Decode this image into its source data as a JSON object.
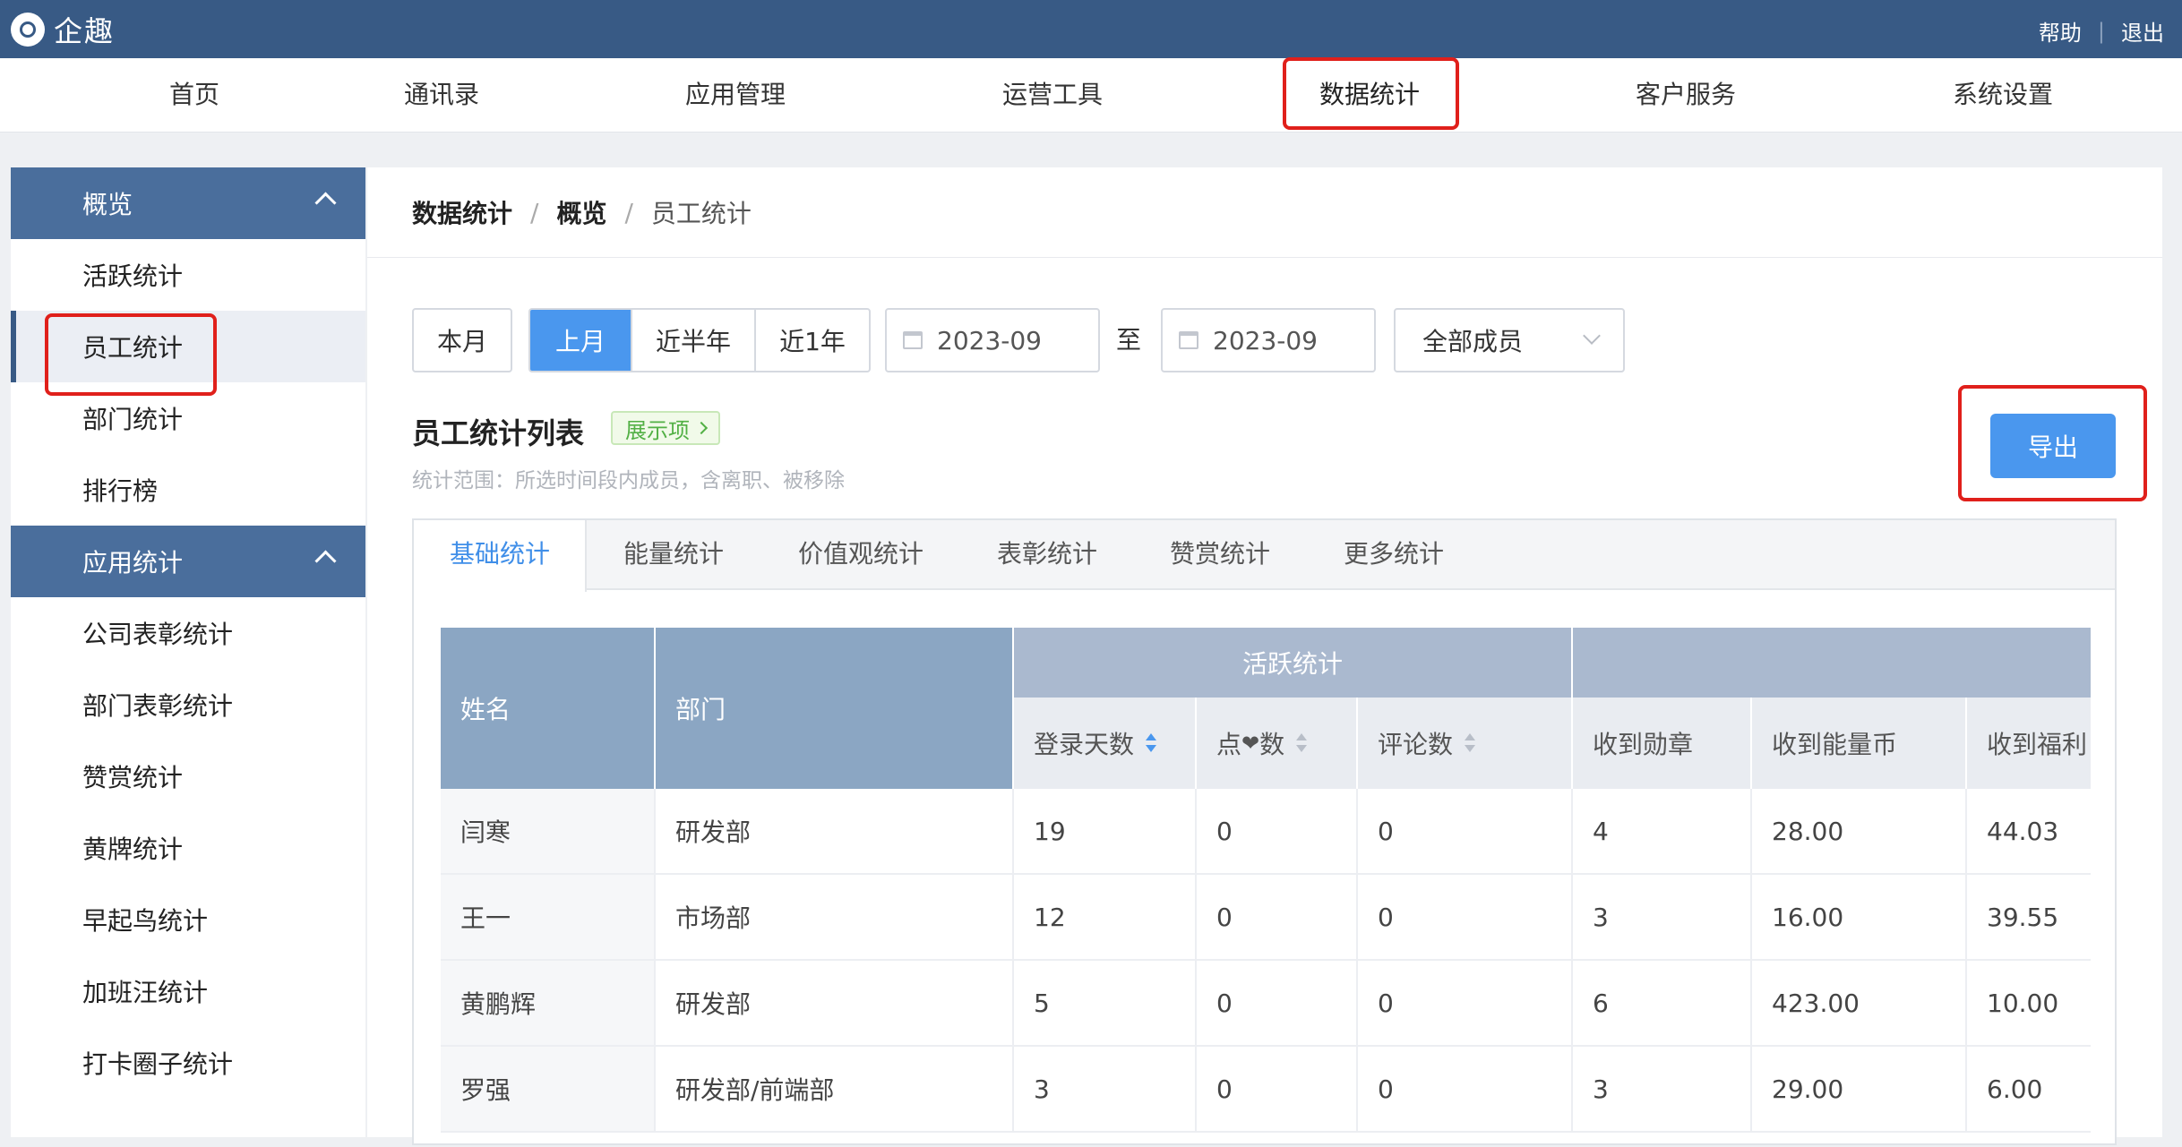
{
  "app": {
    "logo_text": "企趣",
    "help": "帮助",
    "sep": "|",
    "logout": "退出"
  },
  "nav": {
    "items": [
      {
        "label": "首页"
      },
      {
        "label": "通讯录"
      },
      {
        "label": "应用管理"
      },
      {
        "label": "运营工具"
      },
      {
        "label": "数据统计"
      },
      {
        "label": "客户服务"
      },
      {
        "label": "系统设置"
      }
    ],
    "active": "数据统计"
  },
  "sidebar": {
    "groups": [
      {
        "label": "概览",
        "items": [
          {
            "label": "活跃统计"
          },
          {
            "label": "员工统计"
          },
          {
            "label": "部门统计"
          },
          {
            "label": "排行榜"
          }
        ]
      },
      {
        "label": "应用统计",
        "items": [
          {
            "label": "公司表彰统计"
          },
          {
            "label": "部门表彰统计"
          },
          {
            "label": "赞赏统计"
          },
          {
            "label": "黄牌统计"
          },
          {
            "label": "早起鸟统计"
          },
          {
            "label": "加班汪统计"
          },
          {
            "label": "打卡圈子统计"
          }
        ]
      }
    ],
    "active": "员工统计"
  },
  "breadcrumb": {
    "items": [
      "数据统计",
      "概览",
      "员工统计"
    ],
    "sep": "/"
  },
  "filters": {
    "this_month": "本月",
    "ranges": [
      "上月",
      "近半年",
      "近1年"
    ],
    "active_range": "上月",
    "start_date": "2023-09",
    "to": "至",
    "end_date": "2023-09",
    "member_select": "全部成员"
  },
  "list": {
    "title": "员工统计列表",
    "tag": "展示项",
    "note": "统计范围：所选时间段内成员，含离职、被移除",
    "export": "导出"
  },
  "tabs": [
    "基础统计",
    "能量统计",
    "价值观统计",
    "表彰统计",
    "赞赏统计",
    "更多统计"
  ],
  "active_tab": "基础统计",
  "table": {
    "col_name": "姓名",
    "col_dept": "部门",
    "group_active": "活跃统计",
    "group_second": "",
    "sub_headers": [
      "登录天数",
      "点",
      "数",
      "评论数",
      "收到勋章",
      "收到能量币",
      "收到福利"
    ],
    "heart": "❤",
    "rows": [
      [
        "闫寒",
        "研发部",
        "19",
        "0",
        "0",
        "4",
        "28.00",
        "44.03"
      ],
      [
        "王一",
        "市场部",
        "12",
        "0",
        "0",
        "3",
        "16.00",
        "39.55"
      ],
      [
        "黄鹏辉",
        "研发部",
        "5",
        "0",
        "0",
        "6",
        "423.00",
        "10.00"
      ],
      [
        "罗强",
        "研发部/前端部",
        "3",
        "0",
        "0",
        "3",
        "29.00",
        "6.00"
      ]
    ]
  }
}
